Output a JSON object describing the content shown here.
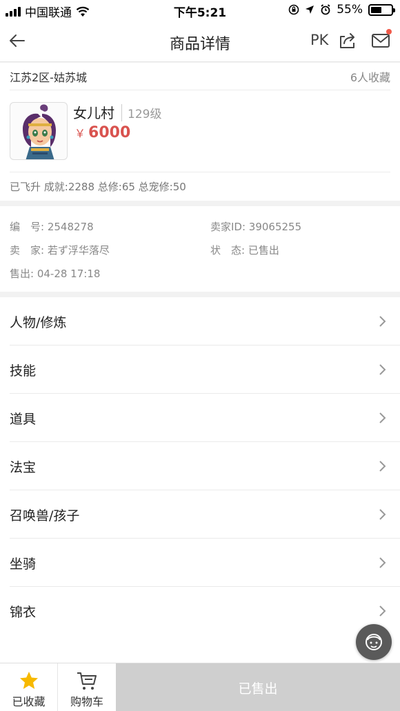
{
  "status_bar": {
    "carrier": "中国联通",
    "time": "下午5:21",
    "battery": "55%",
    "battery_level": 0.55
  },
  "nav": {
    "title": "商品详情",
    "pk": "PK"
  },
  "item": {
    "server": "江苏2区-姑苏城",
    "favorites": "6人收藏",
    "name": "女儿村",
    "level": "129级",
    "currency": "￥",
    "price": "6000",
    "stats": "已飞升 成就:2288 总修:65 总宠修:50"
  },
  "info": {
    "number": "编　号: 2548278",
    "seller_id": "卖家ID: 39065255",
    "seller": "卖　家: 若ず浮华落尽",
    "status": "状　态: 已售出",
    "sold_time": "售出: 04-28 17:18"
  },
  "menu": [
    {
      "label": "人物/修炼"
    },
    {
      "label": "技能"
    },
    {
      "label": "道具"
    },
    {
      "label": "法宝"
    },
    {
      "label": "召唤兽/孩子"
    },
    {
      "label": "坐骑"
    },
    {
      "label": "锦衣"
    }
  ],
  "bottom_bar": {
    "favorite": "已收藏",
    "cart": "购物车",
    "action": "已售出"
  },
  "colors": {
    "price": "#d9534f",
    "star": "#f7b900",
    "disabled": "#cfcfcf"
  }
}
